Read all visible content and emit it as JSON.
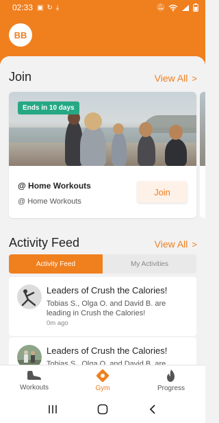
{
  "statusbar": {
    "time": "02:33"
  },
  "profile": {
    "initials": "BB"
  },
  "join": {
    "title": "Join",
    "view_all": "View All",
    "card": {
      "badge": "Ends in 10 days",
      "title": "@ Home Workouts",
      "subtitle": "@ Home Workouts",
      "button": "Join"
    }
  },
  "feed": {
    "title": "Activity Feed",
    "view_all": "View All",
    "tabs": [
      {
        "label": "Activity Feed",
        "active": true
      },
      {
        "label": "My Activities",
        "active": false
      }
    ],
    "items": [
      {
        "title": "Leaders of Crush the Calories!",
        "body": "Tobias S., Olga O. and David B. are leading in Crush the Calories!",
        "time": "0m ago"
      },
      {
        "title": "Leaders of Crush the Calories!",
        "body": "Tobias S., Olga O. and David B. are",
        "time": ""
      }
    ]
  },
  "nav": {
    "items": [
      {
        "label": "Workouts",
        "icon": "shoe-icon",
        "active": false
      },
      {
        "label": "Gym",
        "icon": "gym-location-icon",
        "active": true
      },
      {
        "label": "Progress",
        "icon": "flame-icon",
        "active": false
      }
    ]
  },
  "colors": {
    "accent": "#f07f1e",
    "badge": "#26a884"
  }
}
